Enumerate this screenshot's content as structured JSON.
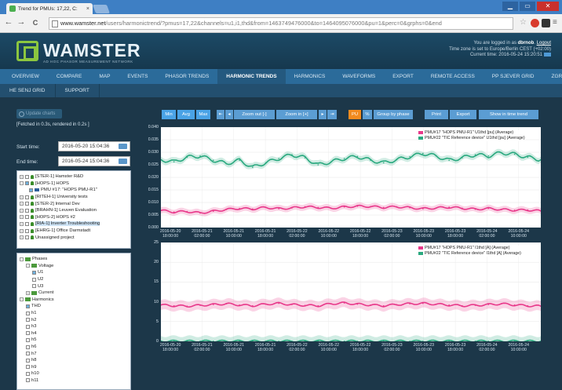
{
  "browser": {
    "tab_title": "Trend for PMUs: 17,22, C:",
    "tab_close": "×",
    "url_host": "www.wamster.net",
    "url_path": "/users/harmonictrend/?pmus=17,22&channels=u1,i1,thd&from=1463749476000&to=1464095076000&pu=1&perc=0&grphs=0&end",
    "nav_back": "←",
    "nav_forward": "→",
    "nav_reload": "C",
    "win_min": "▁",
    "win_max": "▭",
    "win_close": "✕"
  },
  "header": {
    "logo": "WAMSTER",
    "logo_sub": "AD HOC PHASOR MEASUREMENT NETWORK",
    "logged_prefix": "You are logged in as",
    "user": "dbrnob",
    "logout": "Logout",
    "timezone": "Time zone is set to Europe/Berlin CEST (+02:00)",
    "current_time": "Current time: 2016-05-24 15:20:51"
  },
  "nav": {
    "items": [
      "OVERVIEW",
      "COMPARE",
      "MAP",
      "EVENTS",
      "PHASOR TRENDS",
      "HARMONIC TRENDS",
      "HARMONICS",
      "WAVEFORMS",
      "EXPORT",
      "REMOTE ACCESS",
      "PP SJEVER GRID",
      "ZGRING GRID"
    ],
    "active": "HARMONIC TRENDS",
    "sub_items": [
      "HE SENJ GRID",
      "SUPPORT"
    ]
  },
  "left": {
    "update_btn": "Update charts",
    "fetched": "[Fetched in 0.3s, rendered in 0.2s ]",
    "start_label": "Start time:",
    "start_value": "2016-05-20 15:04:36",
    "end_label": "End time:",
    "end_value": "2016-05-24 15:04:36",
    "tree": [
      {
        "label": "[STER-1] Hamster R&D",
        "exp": "+",
        "check": false,
        "icon": "pin"
      },
      {
        "label": "[HOPS-1] HOPS",
        "exp": "−",
        "check": true,
        "icon": "pin"
      },
      {
        "label": "PMU #17: \"HOPS PMU-R1\"",
        "exp": "",
        "check": true,
        "icon": "plug",
        "indent": true
      },
      {
        "label": "[RITEH-1] University tests",
        "exp": "+",
        "check": false,
        "icon": "pin"
      },
      {
        "label": "[STER-2] Internal Dev",
        "exp": "+",
        "check": false,
        "icon": "pin"
      },
      {
        "label": "[BRAHN-1] Leuven Evaluation",
        "exp": "+",
        "check": false,
        "icon": "pin"
      },
      {
        "label": "[HOPS-2] HOPS #2",
        "exp": "+",
        "check": false,
        "icon": "pin"
      },
      {
        "label": "[RIA-1] Inverter Troubleshooting",
        "exp": "+",
        "check": false,
        "icon": "pin",
        "selected": true
      },
      {
        "label": "[EHRG-1] Office Darmstadt",
        "exp": "+",
        "check": false,
        "icon": "pin"
      },
      {
        "label": "Unassigned project",
        "exp": "+",
        "check": false,
        "icon": "pin"
      }
    ],
    "tree2": [
      {
        "label": "Phases",
        "level": 0,
        "exp": "−",
        "folder": true
      },
      {
        "label": "Voltage",
        "level": 1,
        "exp": "−",
        "folder": true
      },
      {
        "label": "U1",
        "level": 2,
        "check": true
      },
      {
        "label": "U2",
        "level": 2,
        "check": false
      },
      {
        "label": "U3",
        "level": 2,
        "check": false
      },
      {
        "label": "Current",
        "level": 1,
        "exp": "+",
        "folder": true
      },
      {
        "label": "Harmonics",
        "level": 0,
        "exp": "−",
        "folder": true
      },
      {
        "label": "THD",
        "level": 1,
        "check": true
      },
      {
        "label": "h1",
        "level": 1,
        "check": false
      },
      {
        "label": "h2",
        "level": 1,
        "check": false
      },
      {
        "label": "h3",
        "level": 1,
        "check": false
      },
      {
        "label": "h4",
        "level": 1,
        "check": false
      },
      {
        "label": "h5",
        "level": 1,
        "check": false
      },
      {
        "label": "h6",
        "level": 1,
        "check": false
      },
      {
        "label": "h7",
        "level": 1,
        "check": false
      },
      {
        "label": "h8",
        "level": 1,
        "check": false
      },
      {
        "label": "h9",
        "level": 1,
        "check": false
      },
      {
        "label": "h10",
        "level": 1,
        "check": false
      },
      {
        "label": "h11",
        "level": 1,
        "check": false
      }
    ]
  },
  "toolbar": {
    "min": "Min",
    "avg": "Avg",
    "max": "Max",
    "first": "⇤",
    "prev": "◂",
    "zoom_out": "Zoom out [-]",
    "zoom_in": "Zoom in [+]",
    "next": "▸",
    "last": "⇥",
    "pu": "PU",
    "percent": "%",
    "group": "Group by phase",
    "print": "Print",
    "export": "Export",
    "show_trend": "Show in time trend"
  },
  "colors": {
    "pink": "#e8388a",
    "green": "#2aa97f",
    "bg": "#1c3749"
  },
  "chart_data": [
    {
      "type": "line",
      "title": "",
      "ylabel": "",
      "ylim": [
        0,
        0.04
      ],
      "yticks": [
        "0.040",
        "0.035",
        "0.030",
        "0.025",
        "0.020",
        "0.015",
        "0.010",
        "0.005",
        "0.000"
      ],
      "xticks": [
        "2016-05-20\n18:00:00",
        "2016-05-21\n02:00:00",
        "2016-05-21\n10:00:00",
        "2016-05-21\n18:00:00",
        "2016-05-22\n02:00:00",
        "2016-05-22\n10:00:00",
        "2016-05-22\n18:00:00",
        "2016-05-23\n02:00:00",
        "2016-05-23\n10:00:00",
        "2016-05-23\n18:00:00",
        "2016-05-24\n02:00:00",
        "2016-05-24\n10:00:00"
      ],
      "series": [
        {
          "name": "PMU#17 \"HOPS PMU-R1\" U1thd [pu] (Average)",
          "color": "#e8388a",
          "values": [
            0.0068,
            0.0062,
            0.0064,
            0.0058,
            0.0065,
            0.0072,
            0.0076,
            0.0074,
            0.008,
            0.0075,
            0.0078,
            0.0083,
            0.008,
            0.0077,
            0.0082,
            0.0085,
            0.0084,
            0.008,
            0.0083,
            0.0079,
            0.0075,
            0.0078,
            0.0081,
            0.0077,
            0.0073,
            0.0076,
            0.0072,
            0.0069,
            0.007,
            0.0066
          ]
        },
        {
          "name": "PMU#22 \"TIC Reference device\" U1thd [pu] (Average)",
          "color": "#2aa97f",
          "values": [
            0.027,
            0.0262,
            0.028,
            0.0285,
            0.0268,
            0.0255,
            0.0268,
            0.024,
            0.0258,
            0.0275,
            0.029,
            0.0278,
            0.025,
            0.0262,
            0.0275,
            0.0283,
            0.0268,
            0.0258,
            0.027,
            0.0282,
            0.0295,
            0.0285,
            0.0268,
            0.0278,
            0.029,
            0.0285,
            0.0298,
            0.0292,
            0.028,
            0.027
          ]
        }
      ]
    },
    {
      "type": "line",
      "title": "",
      "ylabel": "",
      "ylim": [
        0,
        25
      ],
      "yticks": [
        "25",
        "20",
        "15",
        "10",
        "5",
        "0"
      ],
      "xticks": [
        "2016-05-20\n18:00:00",
        "2016-05-21\n02:00:00",
        "2016-05-21\n10:00:00",
        "2016-05-21\n18:00:00",
        "2016-05-22\n02:00:00",
        "2016-05-22\n10:00:00",
        "2016-05-22\n18:00:00",
        "2016-05-23\n02:00:00",
        "2016-05-23\n10:00:00",
        "2016-05-23\n18:00:00",
        "2016-05-24\n02:00:00",
        "2016-05-24\n10:00:00"
      ],
      "series": [
        {
          "name": "PMU#17 \"HOPS PMU-R1\" I1thd [A] (Average)",
          "color": "#e8388a",
          "values": [
            9.2,
            9.0,
            8.9,
            9.1,
            9.3,
            9.5,
            9.2,
            9.0,
            9.4,
            9.6,
            9.3,
            9.1,
            9.0,
            9.5,
            9.7,
            9.4,
            9.2,
            9.0,
            9.3,
            9.5,
            9.6,
            9.4,
            9.2,
            9.0,
            9.1,
            9.3,
            9.5,
            9.2,
            9.0,
            8.9
          ]
        },
        {
          "name": "PMU#22 \"TIC Reference device\" I1thd [A] (Average)",
          "color": "#2aa97f",
          "values": [
            0.05,
            0.05,
            0.05,
            0.05,
            0.05,
            0.05,
            0.05,
            0.05,
            0.05,
            0.05,
            0.05,
            0.05,
            0.05,
            0.05,
            0.05,
            0.05,
            0.05,
            0.05,
            0.05,
            0.05,
            0.05,
            0.05,
            0.05,
            0.05,
            0.05,
            0.05,
            0.05,
            0.05,
            0.05,
            0.05
          ]
        }
      ]
    }
  ]
}
